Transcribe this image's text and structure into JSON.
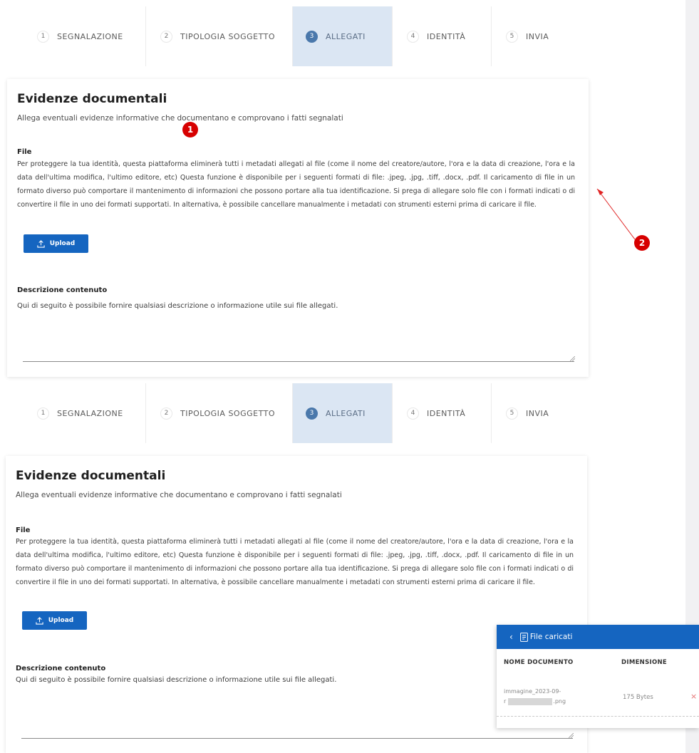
{
  "stepper": {
    "steps": [
      {
        "num": "1",
        "label": "SEGNALAZIONE",
        "active": false
      },
      {
        "num": "2",
        "label": "TIPOLOGIA SOGGETTO",
        "active": false
      },
      {
        "num": "3",
        "label": "ALLEGATI",
        "active": true
      },
      {
        "num": "4",
        "label": "IDENTITÀ",
        "active": false
      },
      {
        "num": "5",
        "label": "INVIA",
        "active": false
      }
    ]
  },
  "form": {
    "title": "Evidenze documentali",
    "subtitle": "Allega eventuali evidenze informative che documentano e comprovano i fatti segnalati",
    "file_label": "File",
    "file_description": "Per proteggere la tua identità, questa piattaforma eliminerà tutti i metadati allegati al file (come il nome del creatore/autore, l'ora e la data di creazione, l'ora e la data dell'ultima modifica, l'ultimo editore, etc) Questa funzione è disponibile per i seguenti formati di file: .jpeg, .jpg, .tiff, .docx, .pdf. Il caricamento di file in un formato diverso può comportare il mantenimento di informazioni che possono portare alla tua identificazione. Si prega di allegare solo file con i formati indicati o di convertire il file in uno dei formati supportati. In alternativa, è possibile cancellare manualmente i metadati con strumenti esterni prima di caricare il file.",
    "upload_label": "Upload",
    "desc_label": "Descrizione contenuto",
    "desc_text": "Qui di seguito è possibile fornire qualsiasi descrizione o informazione utile sui file allegati."
  },
  "annotations": {
    "marker_1": "1",
    "marker_2": "2"
  },
  "file_panel": {
    "back_icon": "chevron-left-icon",
    "title": "File caricati",
    "col_name": "NOME DOCUMENTO",
    "col_size": "DIMENSIONE",
    "file": {
      "name_part1": "immagine_2023-09-",
      "name_part2": "r",
      "name_part3": ".png",
      "size": "175 Bytes",
      "remove": "×"
    }
  },
  "colors": {
    "primary": "#1565c0",
    "step_active_bg": "#dbe6f3",
    "step_active_circle": "#4a78ab",
    "marker": "#d70000"
  }
}
